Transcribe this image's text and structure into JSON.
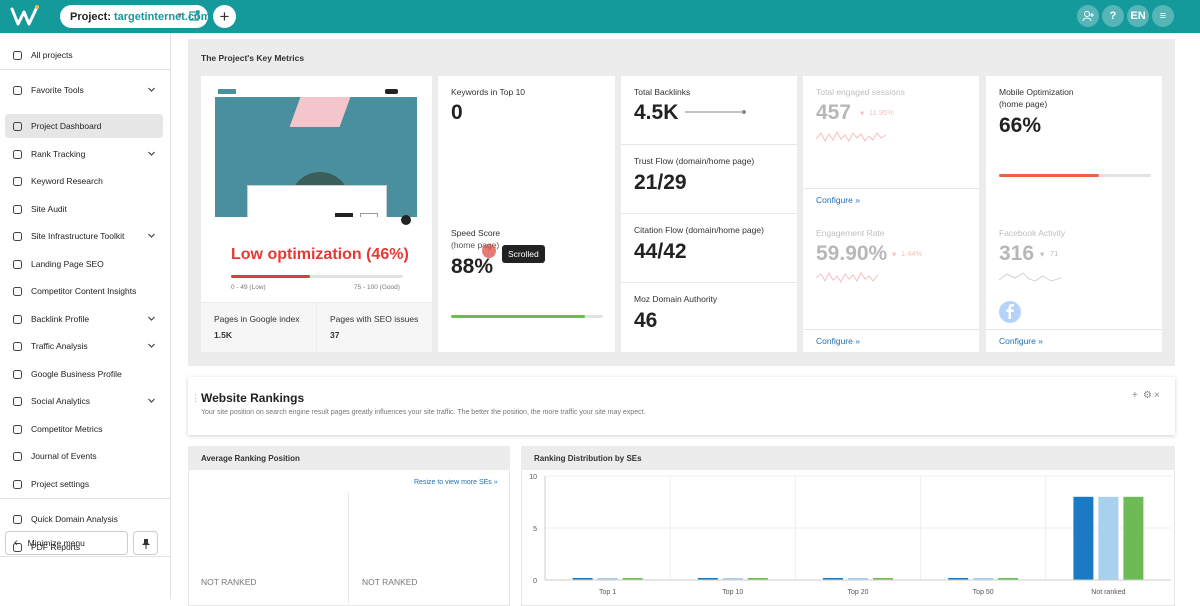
{
  "topbar": {
    "project_label": "Project:",
    "project_name": "targetinternet.com",
    "lang": "EN"
  },
  "sidebar": {
    "items": [
      {
        "label": "All projects",
        "icon": "home-icon"
      },
      {
        "label": "Favorite Tools",
        "icon": "star-icon"
      },
      {
        "label": "Project Dashboard",
        "icon": "dashboard-icon"
      },
      {
        "label": "Rank Tracking",
        "icon": "chart-line-icon"
      },
      {
        "label": "Keyword Research",
        "icon": "key-icon"
      },
      {
        "label": "Site Audit",
        "icon": "heart-pulse-icon"
      },
      {
        "label": "Site Infrastructure Toolkit",
        "icon": "tools-icon"
      },
      {
        "label": "Landing Page SEO",
        "icon": "target-icon"
      },
      {
        "label": "Competitor Content Insights",
        "icon": "bulb-icon"
      },
      {
        "label": "Backlink Profile",
        "icon": "link-icon"
      },
      {
        "label": "Traffic Analysis",
        "icon": "bar-chart-icon"
      },
      {
        "label": "Google Business Profile",
        "icon": "map-pin-icon"
      },
      {
        "label": "Social Analytics",
        "icon": "chat-icon"
      },
      {
        "label": "Competitor Metrics",
        "icon": "binoculars-icon"
      },
      {
        "label": "Journal of Events",
        "icon": "calendar-icon"
      },
      {
        "label": "Project settings",
        "icon": "gear-icon"
      },
      {
        "label": "Quick Domain Analysis",
        "icon": "rocket-icon"
      },
      {
        "label": "PDF Reports",
        "icon": "pdf-icon"
      }
    ],
    "minimize": "Minimize menu"
  },
  "key_metrics": {
    "title": "The Project's Key Metrics",
    "optimization": "Low optimization (46%)",
    "optimization_pct": 46,
    "range_low": "0 - 49 (Low)",
    "range_high": "75 - 100 (Good)",
    "pages_google_label": "Pages in Google index",
    "pages_google_value": "1.5K",
    "pages_issues_label": "Pages with SEO issues",
    "pages_issues_value": "37",
    "keywords_label": "Keywords in Top 10",
    "keywords_value": "0",
    "speed_label": "Speed Score",
    "speed_sub": "(home page)",
    "speed_value": "88%",
    "speed_pct": 88,
    "backlinks_label": "Total Backlinks",
    "backlinks_value": "4.5K",
    "trust_label": "Trust Flow (domain/home page)",
    "trust_value": "21/29",
    "citation_label": "Citation Flow (domain/home page)",
    "citation_value": "44/42",
    "moz_label": "Moz Domain Authority",
    "moz_value": "46",
    "engaged_label": "Total engaged sessions",
    "engaged_value": "457",
    "engaged_delta": "11.95%",
    "engagement_label": "Engagement Rate",
    "engagement_value": "59.90%",
    "engagement_delta": "1.44%",
    "mobile_label": "Mobile Optimization",
    "mobile_sub": "(home page)",
    "mobile_value": "66%",
    "mobile_pct": 66,
    "facebook_label": "Facebook Activity",
    "facebook_value": "316",
    "facebook_delta": "71",
    "configure": "Configure"
  },
  "tooltip": "Scrolled",
  "rankings": {
    "title": "Website Rankings",
    "description": "Your site position on search engine result pages greatly influences your site traffic. The better the position, the more traffic your site may expect."
  },
  "avg_ranking": {
    "title": "Average Ranking Position",
    "resize_link": "Resize to view more SEs",
    "col1": "NOT RANKED",
    "col2": "NOT RANKED"
  },
  "distribution": {
    "title": "Ranking Distribution by SEs"
  },
  "chart_data": {
    "type": "bar",
    "categories": [
      "Top 1",
      "Top 10",
      "Top 20",
      "Top 50",
      "Not ranked"
    ],
    "series": [
      {
        "values": [
          0,
          0,
          0,
          0,
          8
        ]
      },
      {
        "values": [
          0,
          0,
          0,
          0,
          8
        ]
      },
      {
        "values": [
          0,
          0,
          0,
          0,
          8
        ]
      }
    ],
    "ylim": [
      0,
      10
    ],
    "yticks": [
      "10",
      "5",
      "0"
    ],
    "colors": [
      "#1a7bc4",
      "#a8d1ee",
      "#6dbb54"
    ]
  },
  "colors": {
    "brand": "#159a9c",
    "danger": "#e53935",
    "success": "#6dbb54",
    "link": "#1e6fb5"
  }
}
